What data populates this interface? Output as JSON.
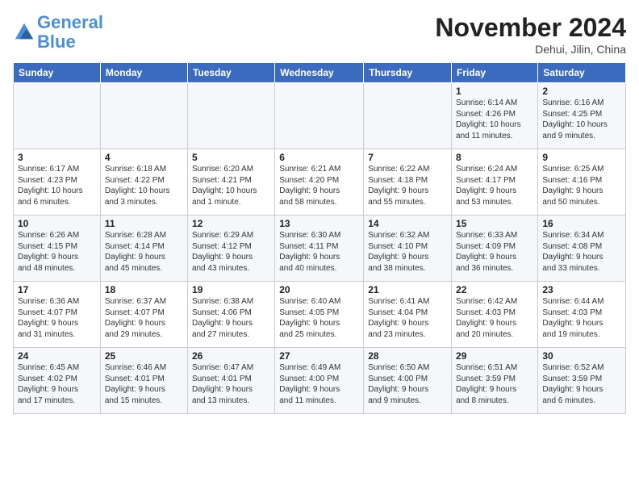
{
  "header": {
    "logo_line1": "General",
    "logo_line2": "Blue",
    "month": "November 2024",
    "location": "Dehui, Jilin, China"
  },
  "weekdays": [
    "Sunday",
    "Monday",
    "Tuesday",
    "Wednesday",
    "Thursday",
    "Friday",
    "Saturday"
  ],
  "weeks": [
    [
      {
        "day": "",
        "info": ""
      },
      {
        "day": "",
        "info": ""
      },
      {
        "day": "",
        "info": ""
      },
      {
        "day": "",
        "info": ""
      },
      {
        "day": "",
        "info": ""
      },
      {
        "day": "1",
        "info": "Sunrise: 6:14 AM\nSunset: 4:26 PM\nDaylight: 10 hours\nand 11 minutes."
      },
      {
        "day": "2",
        "info": "Sunrise: 6:16 AM\nSunset: 4:25 PM\nDaylight: 10 hours\nand 9 minutes."
      }
    ],
    [
      {
        "day": "3",
        "info": "Sunrise: 6:17 AM\nSunset: 4:23 PM\nDaylight: 10 hours\nand 6 minutes."
      },
      {
        "day": "4",
        "info": "Sunrise: 6:18 AM\nSunset: 4:22 PM\nDaylight: 10 hours\nand 3 minutes."
      },
      {
        "day": "5",
        "info": "Sunrise: 6:20 AM\nSunset: 4:21 PM\nDaylight: 10 hours\nand 1 minute."
      },
      {
        "day": "6",
        "info": "Sunrise: 6:21 AM\nSunset: 4:20 PM\nDaylight: 9 hours\nand 58 minutes."
      },
      {
        "day": "7",
        "info": "Sunrise: 6:22 AM\nSunset: 4:18 PM\nDaylight: 9 hours\nand 55 minutes."
      },
      {
        "day": "8",
        "info": "Sunrise: 6:24 AM\nSunset: 4:17 PM\nDaylight: 9 hours\nand 53 minutes."
      },
      {
        "day": "9",
        "info": "Sunrise: 6:25 AM\nSunset: 4:16 PM\nDaylight: 9 hours\nand 50 minutes."
      }
    ],
    [
      {
        "day": "10",
        "info": "Sunrise: 6:26 AM\nSunset: 4:15 PM\nDaylight: 9 hours\nand 48 minutes."
      },
      {
        "day": "11",
        "info": "Sunrise: 6:28 AM\nSunset: 4:14 PM\nDaylight: 9 hours\nand 45 minutes."
      },
      {
        "day": "12",
        "info": "Sunrise: 6:29 AM\nSunset: 4:12 PM\nDaylight: 9 hours\nand 43 minutes."
      },
      {
        "day": "13",
        "info": "Sunrise: 6:30 AM\nSunset: 4:11 PM\nDaylight: 9 hours\nand 40 minutes."
      },
      {
        "day": "14",
        "info": "Sunrise: 6:32 AM\nSunset: 4:10 PM\nDaylight: 9 hours\nand 38 minutes."
      },
      {
        "day": "15",
        "info": "Sunrise: 6:33 AM\nSunset: 4:09 PM\nDaylight: 9 hours\nand 36 minutes."
      },
      {
        "day": "16",
        "info": "Sunrise: 6:34 AM\nSunset: 4:08 PM\nDaylight: 9 hours\nand 33 minutes."
      }
    ],
    [
      {
        "day": "17",
        "info": "Sunrise: 6:36 AM\nSunset: 4:07 PM\nDaylight: 9 hours\nand 31 minutes."
      },
      {
        "day": "18",
        "info": "Sunrise: 6:37 AM\nSunset: 4:07 PM\nDaylight: 9 hours\nand 29 minutes."
      },
      {
        "day": "19",
        "info": "Sunrise: 6:38 AM\nSunset: 4:06 PM\nDaylight: 9 hours\nand 27 minutes."
      },
      {
        "day": "20",
        "info": "Sunrise: 6:40 AM\nSunset: 4:05 PM\nDaylight: 9 hours\nand 25 minutes."
      },
      {
        "day": "21",
        "info": "Sunrise: 6:41 AM\nSunset: 4:04 PM\nDaylight: 9 hours\nand 23 minutes."
      },
      {
        "day": "22",
        "info": "Sunrise: 6:42 AM\nSunset: 4:03 PM\nDaylight: 9 hours\nand 20 minutes."
      },
      {
        "day": "23",
        "info": "Sunrise: 6:44 AM\nSunset: 4:03 PM\nDaylight: 9 hours\nand 19 minutes."
      }
    ],
    [
      {
        "day": "24",
        "info": "Sunrise: 6:45 AM\nSunset: 4:02 PM\nDaylight: 9 hours\nand 17 minutes."
      },
      {
        "day": "25",
        "info": "Sunrise: 6:46 AM\nSunset: 4:01 PM\nDaylight: 9 hours\nand 15 minutes."
      },
      {
        "day": "26",
        "info": "Sunrise: 6:47 AM\nSunset: 4:01 PM\nDaylight: 9 hours\nand 13 minutes."
      },
      {
        "day": "27",
        "info": "Sunrise: 6:49 AM\nSunset: 4:00 PM\nDaylight: 9 hours\nand 11 minutes."
      },
      {
        "day": "28",
        "info": "Sunrise: 6:50 AM\nSunset: 4:00 PM\nDaylight: 9 hours\nand 9 minutes."
      },
      {
        "day": "29",
        "info": "Sunrise: 6:51 AM\nSunset: 3:59 PM\nDaylight: 9 hours\nand 8 minutes."
      },
      {
        "day": "30",
        "info": "Sunrise: 6:52 AM\nSunset: 3:59 PM\nDaylight: 9 hours\nand 6 minutes."
      }
    ]
  ]
}
